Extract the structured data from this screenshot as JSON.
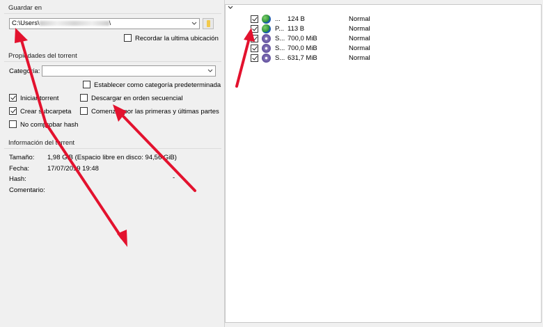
{
  "save": {
    "group_title": "Guardar en",
    "path_value": "C:\\Users\\",
    "path_tail": "\\",
    "remember_label": "Recordar la ultima ubicación"
  },
  "props": {
    "group_title": "Propiedades del torrent",
    "category_label": "Categoría:",
    "category_value": "",
    "set_default_label": "Establecer como categoría predeterminada",
    "start_label": "Iniciar torrent",
    "sequential_label": "Descargar en orden secuencial",
    "subfolder_label": "Crear subcarpeta",
    "first_last_label": "Comenzar por las primeras y últimas partes",
    "no_hash_label": "No comprobar hash",
    "start_checked": true,
    "subfolder_checked": true,
    "sequential_checked": false,
    "first_last_checked": false,
    "no_hash_checked": false,
    "set_default_checked": false,
    "remember_checked": false
  },
  "info": {
    "group_title": "Información del torrent",
    "size_label": "Tamaño:",
    "size_value": "1,98 GiB (Espacio libre en disco: 94,56 GiB)",
    "date_label": "Fecha:",
    "date_value": "17/07/2019 19:48",
    "hash_label": "Hash:",
    "hash_value": "-",
    "comment_label": "Comentario:",
    "comment_value": ""
  },
  "files": [
    {
      "name": "...",
      "size": "124 B",
      "priority": "Normal",
      "icon": "globe-icon",
      "checked": true
    },
    {
      "name": "P...",
      "size": "113 B",
      "priority": "Normal",
      "icon": "globe-icon",
      "checked": true
    },
    {
      "name": "S...",
      "size": "700,0 MiB",
      "priority": "Normal",
      "icon": "disc-icon",
      "checked": true
    },
    {
      "name": "S...",
      "size": "700,0 MiB",
      "priority": "Normal",
      "icon": "disc-icon",
      "checked": true
    },
    {
      "name": "S...",
      "size": "631,7 MiB",
      "priority": "Normal",
      "icon": "disc-icon",
      "checked": true
    }
  ],
  "colors": {
    "annotation_arrow": "#e3122e",
    "folder_icon": "#f2c94c"
  }
}
